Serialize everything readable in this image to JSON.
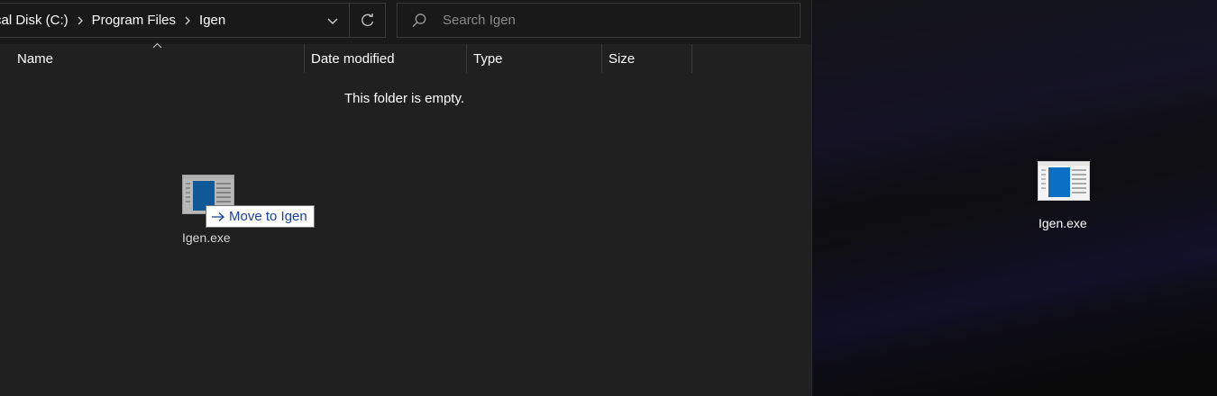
{
  "explorer": {
    "breadcrumb": [
      "cal Disk (C:)",
      "Program Files",
      "Igen"
    ],
    "search": {
      "placeholder": "Search Igen"
    },
    "columns": [
      "Name",
      "Date modified",
      "Type",
      "Size"
    ],
    "empty_message": "This folder is empty.",
    "dragged_item": {
      "label": "Igen.exe",
      "tooltip": "Move to Igen",
      "icon": "exe-file-icon"
    }
  },
  "desktop": {
    "icons": [
      {
        "label": "Igen.exe",
        "icon": "exe-file-icon"
      }
    ]
  },
  "colors": {
    "explorer_background": "#202020",
    "address_background": "#191919",
    "tooltip_text": "#1a3f9c",
    "file_icon_blue": "#0b6fc6"
  }
}
